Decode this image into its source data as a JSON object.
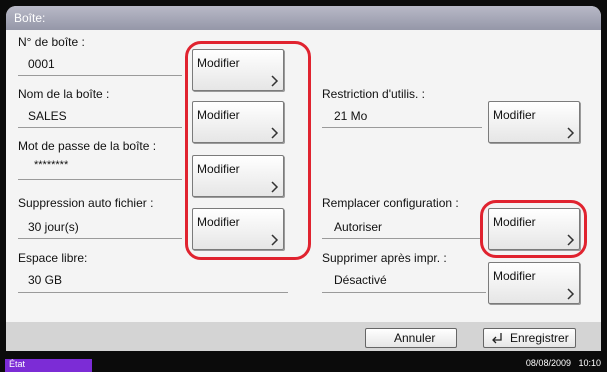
{
  "window": {
    "title": "Boîte:"
  },
  "fields": {
    "box_number": {
      "label": "N° de boîte :",
      "value": "0001"
    },
    "box_name": {
      "label": "Nom de la boîte :",
      "value": "SALES"
    },
    "box_password": {
      "label": "Mot de passe de la boîte :",
      "value": "********"
    },
    "auto_delete": {
      "label": "Suppression auto fichier :",
      "value": "30 jour(s)"
    },
    "free_space": {
      "label": "Espace libre:",
      "value": "30  GB"
    },
    "usage_restriction": {
      "label": "Restriction d'utilis. :",
      "value": "21 Mo"
    },
    "overwrite_setting": {
      "label": "Remplacer configuration :",
      "value": "Autoriser"
    },
    "delete_after_print": {
      "label": "Supprimer après impr. :",
      "value": "Désactivé"
    }
  },
  "buttons": {
    "modify_label": "Modifier",
    "cancel": "Annuler",
    "save": "Enregistrer"
  },
  "status_bar": {
    "state": "État",
    "datetime": "08/08/2009   10:10"
  },
  "colors": {
    "highlight": "#e0232f",
    "state_badge": "#7c2cd6",
    "title_bar": "#a6a8b8"
  }
}
